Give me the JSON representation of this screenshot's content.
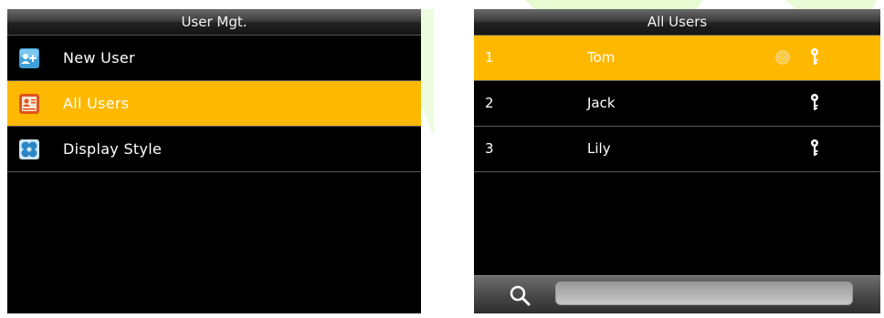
{
  "left_screen": {
    "title": "User Mgt.",
    "menu": [
      {
        "label": "New User",
        "icon": "new-user-icon",
        "selected": false
      },
      {
        "label": "All Users",
        "icon": "all-users-icon",
        "selected": true
      },
      {
        "label": "Display Style",
        "icon": "display-style-icon",
        "selected": false
      }
    ]
  },
  "right_screen": {
    "title": "All Users",
    "users": [
      {
        "number": "1",
        "name": "Tom",
        "fingerprint": true,
        "password": true,
        "selected": true
      },
      {
        "number": "2",
        "name": "Jack",
        "fingerprint": false,
        "password": true,
        "selected": false
      },
      {
        "number": "3",
        "name": "Lily",
        "fingerprint": false,
        "password": true,
        "selected": false
      }
    ],
    "search": {
      "value": "",
      "placeholder": ""
    }
  },
  "colors": {
    "highlight": "#ffb800",
    "screen_bg": "#000000",
    "watermark": "#d9f7b8"
  }
}
